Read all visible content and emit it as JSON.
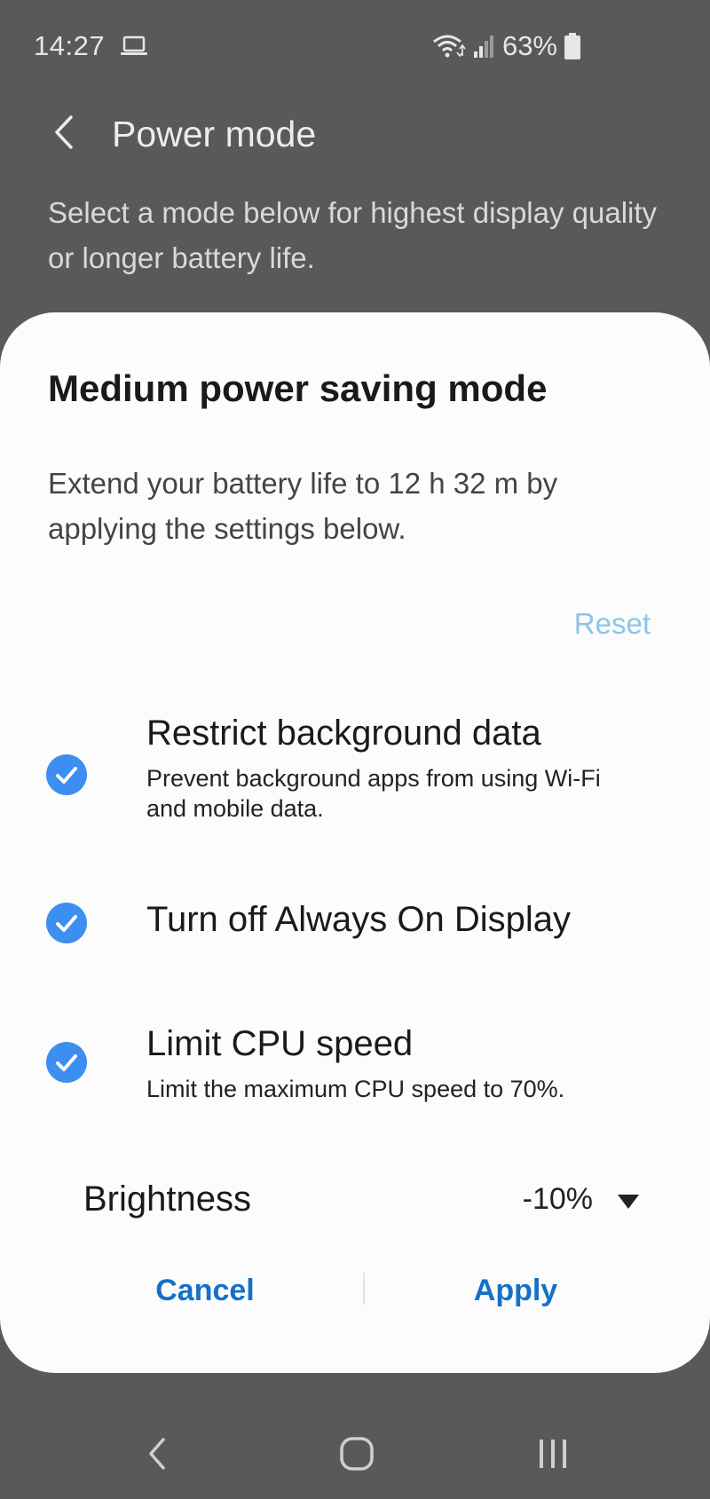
{
  "status_bar": {
    "time": "14:27",
    "battery_percent": "63%",
    "icons": [
      "laptop-icon",
      "wifi-icon",
      "signal-icon",
      "battery-icon"
    ]
  },
  "header": {
    "title": "Power mode",
    "description": "Select a mode below for highest display quality or longer battery life."
  },
  "dialog": {
    "title": "Medium power saving mode",
    "description": "Extend your battery life to 12 h 32 m by applying the settings below.",
    "reset_label": "Reset",
    "options": [
      {
        "title": "Restrict background data",
        "subtitle": "Prevent background apps from using Wi-Fi and mobile data.",
        "checked": true
      },
      {
        "title": "Turn off Always On Display",
        "subtitle": "",
        "checked": true
      },
      {
        "title": "Limit CPU speed",
        "subtitle": "Limit the maximum CPU speed to 70%.",
        "checked": true
      }
    ],
    "brightness": {
      "label": "Brightness",
      "value": "-10%"
    },
    "cancel_label": "Cancel",
    "apply_label": "Apply"
  },
  "colors": {
    "accent": "#1570c8",
    "check": "#3c8ff0",
    "reset_disabled": "#8ec4ea",
    "scrim": "#595959"
  }
}
